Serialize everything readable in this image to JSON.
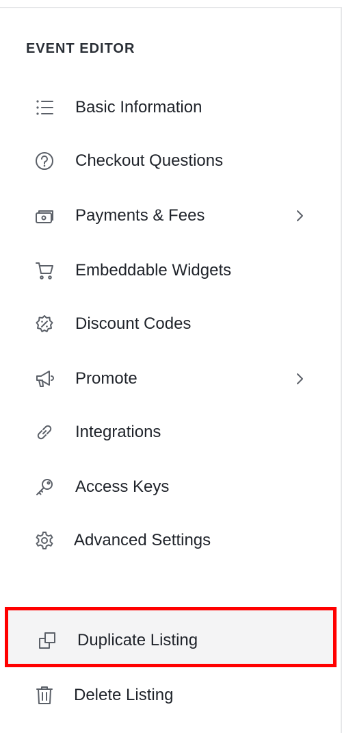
{
  "sidebar": {
    "title": "EVENT EDITOR",
    "items": [
      {
        "label": "Basic Information",
        "icon": "list-icon",
        "has_submenu": false
      },
      {
        "label": "Checkout Questions",
        "icon": "question-circle-icon",
        "has_submenu": false
      },
      {
        "label": "Payments & Fees",
        "icon": "payment-card-icon",
        "has_submenu": true
      },
      {
        "label": "Embeddable Widgets",
        "icon": "cart-icon",
        "has_submenu": false
      },
      {
        "label": "Discount Codes",
        "icon": "discount-badge-icon",
        "has_submenu": false
      },
      {
        "label": "Promote",
        "icon": "megaphone-icon",
        "has_submenu": true
      },
      {
        "label": "Integrations",
        "icon": "link-icon",
        "has_submenu": false
      },
      {
        "label": "Access Keys",
        "icon": "key-icon",
        "has_submenu": false
      },
      {
        "label": "Advanced Settings",
        "icon": "gear-icon",
        "has_submenu": false
      }
    ],
    "actions": [
      {
        "label": "Duplicate Listing",
        "icon": "duplicate-icon",
        "highlighted": true
      },
      {
        "label": "Delete Listing",
        "icon": "trash-icon",
        "highlighted": false
      }
    ]
  },
  "colors": {
    "text": "#1f232a",
    "icon": "#5b6068",
    "highlight_border": "#ff0000",
    "highlight_bg": "#f4f4f5",
    "divider": "#e6e7e9"
  }
}
